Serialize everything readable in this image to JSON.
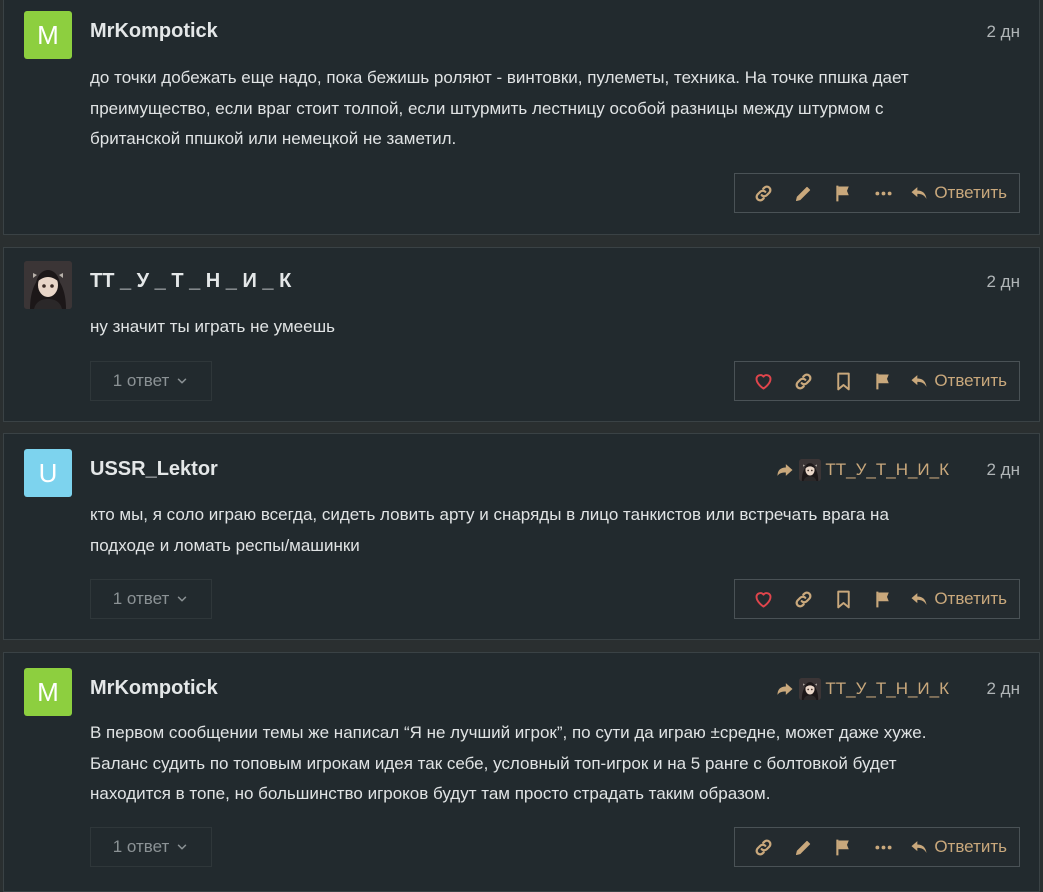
{
  "posts": [
    {
      "username": "MrKompotick",
      "avatar_letter": "M",
      "avatar_color": "#8dcf3f",
      "date": "2 дн",
      "lines": [
        "до точки добежать еще надо, пока бежишь роляют - винтовки, пулеметы, техника. На точке ппшка дает",
        "преимущество, если враг стоит толпой, если штурмить лестницу особой разницы между штурмом с",
        "британской ппшкой или немецкой не заметил."
      ],
      "reply_label": "Ответить"
    },
    {
      "username": "ТТ _ У _ Т _ Н _ И _ К",
      "date": "2 дн",
      "lines": [
        "ну значит ты играть не умеешь"
      ],
      "replies_label": "1 ответ",
      "reply_label": "Ответить"
    },
    {
      "username": "USSR_Lektor",
      "avatar_letter": "U",
      "avatar_color": "#7dd3ee",
      "date": "2 дн",
      "reply_to": "ТТ_У_Т_Н_И_К",
      "lines": [
        "кто мы, я соло играю всегда, сидеть ловить арту и снаряды в лицо танкистов или встречать врага на",
        "подходе и ломать респы/машинки"
      ],
      "replies_label": "1 ответ",
      "reply_label": "Ответить"
    },
    {
      "username": "MrKompotick",
      "avatar_letter": "M",
      "avatar_color": "#8dcf3f",
      "date": "2 дн",
      "reply_to": "ТТ_У_Т_Н_И_К",
      "lines": [
        "В первом сообщении темы же написал “Я не лучший игрок”, по сути да играю ±средне, может даже хуже.",
        "Баланс судить по топовым игрокам идея так себе, условный топ-игрок и на 5 ранге с болтовкой будет",
        "находится в топе, но большинство игроков будут там просто страдать таким образом."
      ],
      "replies_label": "1 ответ",
      "reply_label": "Ответить"
    }
  ],
  "colors": {
    "accent": "#c9a87c",
    "heart": "#e0454c",
    "post_bg": "#222a2e",
    "page_bg": "#2a2f30"
  },
  "icons": [
    "link-icon",
    "pencil-icon",
    "flag-icon",
    "ellipsis-icon",
    "reply-icon",
    "heart-icon",
    "bookmark-icon",
    "chevron-down-icon",
    "reply-arrow-icon"
  ]
}
